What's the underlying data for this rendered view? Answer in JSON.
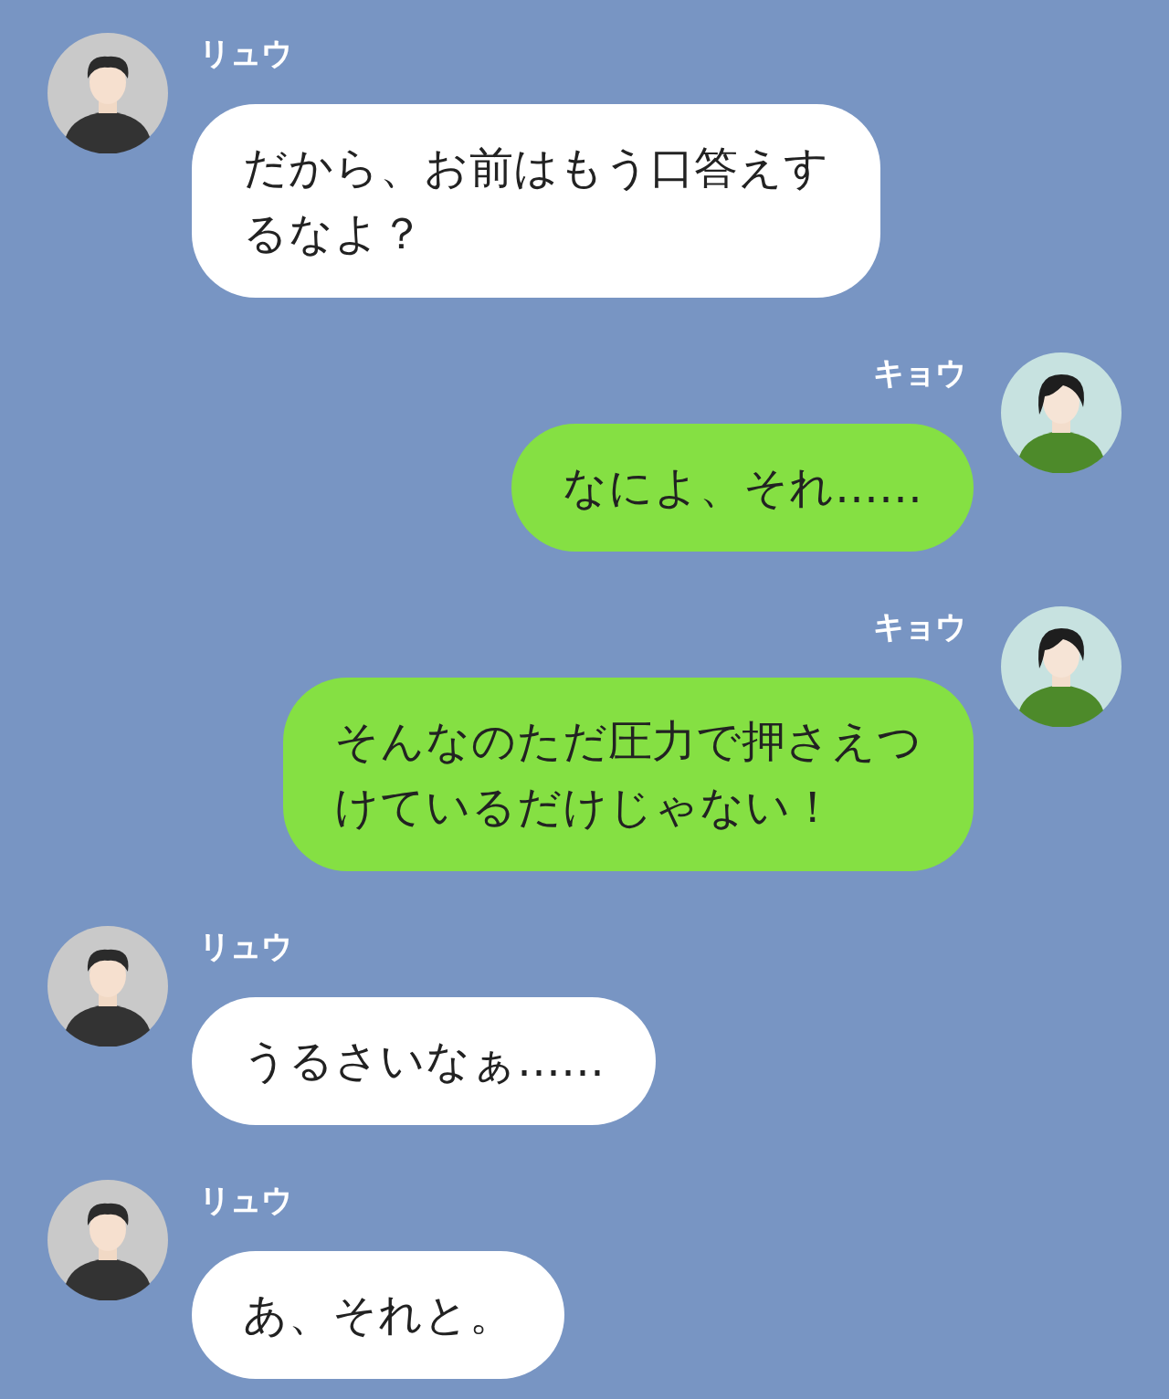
{
  "messages": [
    {
      "sender": "リュウ",
      "outgoing": false,
      "lines": [
        "だから、お前はもう口答えす",
        "るなよ？"
      ]
    },
    {
      "sender": "キョウ",
      "outgoing": true,
      "lines": [
        "なによ、それ……"
      ]
    },
    {
      "sender": "キョウ",
      "outgoing": true,
      "lines": [
        "そんなのただ圧力で押さえつ",
        "けているだけじゃない！"
      ]
    },
    {
      "sender": "リュウ",
      "outgoing": false,
      "lines": [
        "うるさいなぁ……"
      ]
    },
    {
      "sender": "リュウ",
      "outgoing": false,
      "lines": [
        "あ、それと。"
      ]
    }
  ]
}
